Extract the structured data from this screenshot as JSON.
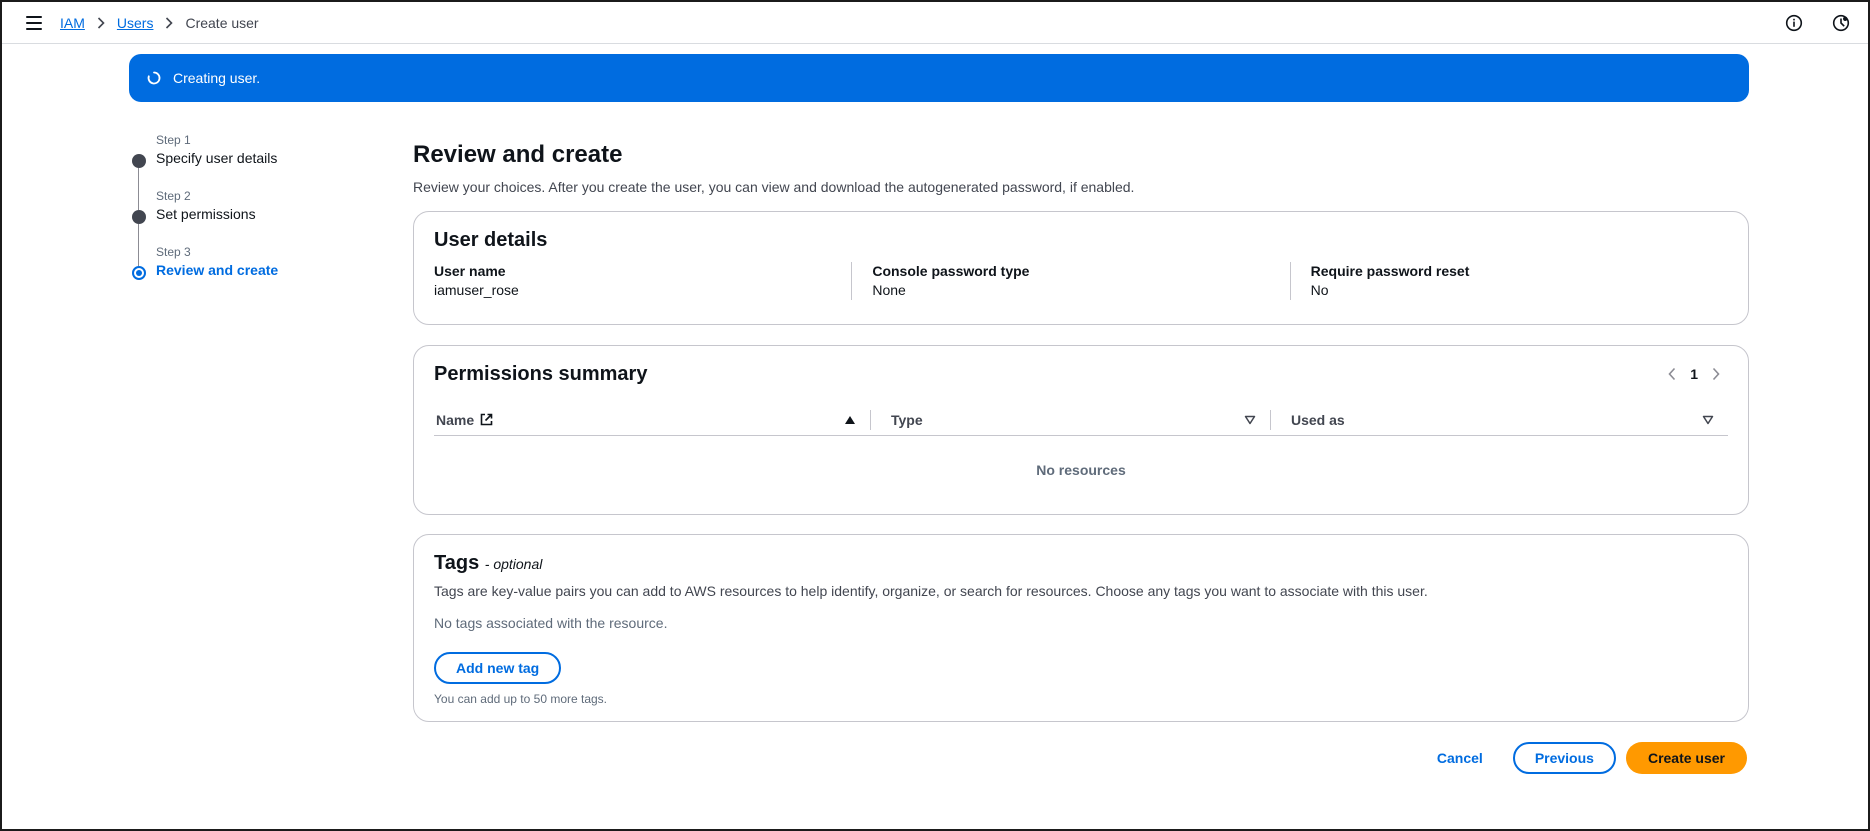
{
  "breadcrumb": {
    "iam": "IAM",
    "users": "Users",
    "current": "Create user"
  },
  "flash": {
    "message": "Creating user."
  },
  "steps": [
    {
      "num": "Step 1",
      "label": "Specify user details"
    },
    {
      "num": "Step 2",
      "label": "Set permissions"
    },
    {
      "num": "Step 3",
      "label": "Review and create"
    }
  ],
  "page": {
    "title": "Review and create",
    "description": "Review your choices. After you create the user, you can view and download the autogenerated password, if enabled."
  },
  "user_details": {
    "title": "User details",
    "fields": [
      {
        "key": "User name",
        "value": "iamuser_rose"
      },
      {
        "key": "Console password type",
        "value": "None"
      },
      {
        "key": "Require password reset",
        "value": "No"
      }
    ]
  },
  "permissions": {
    "title": "Permissions summary",
    "page": "1",
    "columns": [
      "Name",
      "Type",
      "Used as"
    ],
    "empty": "No resources"
  },
  "tags": {
    "title": "Tags",
    "optional": "- optional",
    "description": "Tags are key-value pairs you can add to AWS resources to help identify, organize, or search for resources. Choose any tags you want to associate with this user.",
    "none": "No tags associated with the resource.",
    "add_label": "Add new tag",
    "hint": "You can add up to 50 more tags."
  },
  "actions": {
    "cancel": "Cancel",
    "previous": "Previous",
    "create": "Create user"
  },
  "colors": {
    "primary": "#006ce0",
    "accent": "#ff9900"
  }
}
